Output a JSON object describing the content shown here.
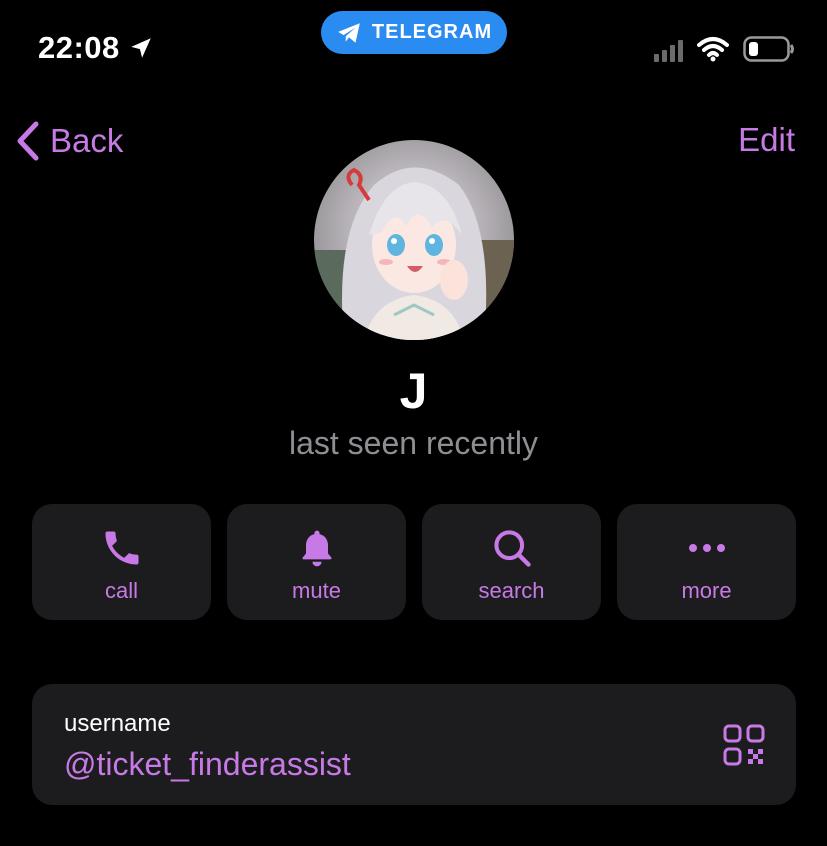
{
  "status_bar": {
    "time": "22:08",
    "pill_label": "TELEGRAM",
    "icons": [
      "location-arrow-icon",
      "telegram-icon",
      "signal-icon",
      "wifi-icon",
      "battery-icon"
    ]
  },
  "nav": {
    "back_label": "Back",
    "edit_label": "Edit"
  },
  "profile": {
    "name": "J",
    "status": "last seen recently"
  },
  "actions": [
    {
      "label": "call",
      "icon": "phone-icon"
    },
    {
      "label": "mute",
      "icon": "bell-icon"
    },
    {
      "label": "search",
      "icon": "magnifier-icon"
    },
    {
      "label": "more",
      "icon": "ellipsis-icon"
    }
  ],
  "username_card": {
    "label": "username",
    "value": "@ticket_finderassist",
    "icon": "qr-code-icon"
  },
  "colors": {
    "accent": "#c77ae6",
    "background": "#000000",
    "card": "#1c1c1e",
    "secondary_text": "#8e8e93",
    "telegram_blue": "#2a8cf0"
  }
}
